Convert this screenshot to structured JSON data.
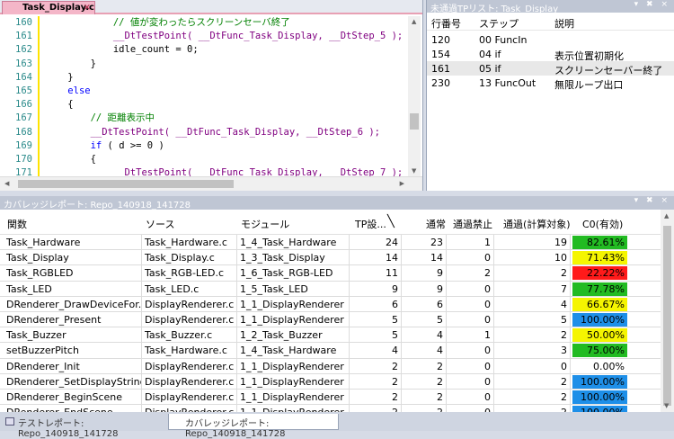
{
  "editor": {
    "tab_label": "Task_Display.c",
    "close_glyph": "×",
    "lines": [
      {
        "n": "160",
        "segs": [
          {
            "t": "            ",
            "c": ""
          },
          {
            "t": "// 値が変わったらスクリーンセーバ終了",
            "c": "cm"
          }
        ]
      },
      {
        "n": "161",
        "segs": [
          {
            "t": "            ",
            "c": ""
          },
          {
            "t": "__DtTestPoint( __DtFunc_Task_Display, __DtStep_5 );",
            "c": "fn"
          }
        ]
      },
      {
        "n": "162",
        "segs": [
          {
            "t": "            idle_count = 0;",
            "c": ""
          }
        ]
      },
      {
        "n": "163",
        "segs": [
          {
            "t": "        }",
            "c": ""
          }
        ]
      },
      {
        "n": "164",
        "segs": [
          {
            "t": "    }",
            "c": ""
          }
        ]
      },
      {
        "n": "165",
        "segs": [
          {
            "t": "    ",
            "c": ""
          },
          {
            "t": "else",
            "c": "kw"
          }
        ]
      },
      {
        "n": "166",
        "segs": [
          {
            "t": "    {",
            "c": ""
          }
        ]
      },
      {
        "n": "167",
        "segs": [
          {
            "t": "        ",
            "c": ""
          },
          {
            "t": "// 距離表示中",
            "c": "cm"
          }
        ]
      },
      {
        "n": "168",
        "segs": [
          {
            "t": "        ",
            "c": ""
          },
          {
            "t": "__DtTestPoint( __DtFunc_Task_Display, __DtStep_6 );",
            "c": "fn"
          }
        ]
      },
      {
        "n": "169",
        "segs": [
          {
            "t": "        ",
            "c": ""
          },
          {
            "t": "if",
            "c": "kw"
          },
          {
            "t": " ( d >= 0 )",
            "c": ""
          }
        ]
      },
      {
        "n": "170",
        "segs": [
          {
            "t": "        {",
            "c": ""
          }
        ]
      },
      {
        "n": "171",
        "segs": [
          {
            "t": "            ",
            "c": ""
          },
          {
            "t": "__DtTestPoint( __DtFunc_Task_Display, __DtStep_7 );",
            "c": "fn"
          }
        ]
      }
    ]
  },
  "untested": {
    "title": "未通過TPリスト: Task_Display",
    "icons": "▾ ✖ ×",
    "headers": [
      "行番号",
      "ステップ",
      "説明"
    ],
    "rows": [
      {
        "line": "120",
        "step": "00 FuncIn",
        "desc": ""
      },
      {
        "line": "154",
        "step": "04 if",
        "desc": "表示位置初期化"
      },
      {
        "line": "161",
        "step": "05 if",
        "desc": "スクリーンセーバー終了",
        "selected": true
      },
      {
        "line": "230",
        "step": "13 FuncOut",
        "desc": "無限ループ出口"
      }
    ]
  },
  "coverage": {
    "title": "カバレッジレポート: Repo_140918_141728",
    "icons": "▾ ✖ ×",
    "headers": {
      "func": "関数",
      "src": "ソース",
      "mod": "モジュール",
      "tp": "TP設...",
      "pass": "通常",
      "ban": "通過禁止",
      "calc": "通過(計算対象)",
      "c0": "C0(有効)"
    },
    "rows": [
      {
        "func": "Task_Hardware",
        "src": "Task_Hardware.c",
        "mod": "1_4_Task_Hardware",
        "tp": "24",
        "pass": "23",
        "ban": "1",
        "calc": "19",
        "c0": "82.61%",
        "color": "#22bb22"
      },
      {
        "func": "Task_Display",
        "src": "Task_Display.c",
        "mod": "1_3_Task_Display",
        "tp": "14",
        "pass": "14",
        "ban": "0",
        "calc": "10",
        "c0": "71.43%",
        "color": "#f5f500"
      },
      {
        "func": "Task_RGBLED",
        "src": "Task_RGB-LED.c",
        "mod": "1_6_Task_RGB-LED",
        "tp": "11",
        "pass": "9",
        "ban": "2",
        "calc": "2",
        "c0": "22.22%",
        "color": "#ff1a1a"
      },
      {
        "func": "Task_LED",
        "src": "Task_LED.c",
        "mod": "1_5_Task_LED",
        "tp": "9",
        "pass": "9",
        "ban": "0",
        "calc": "7",
        "c0": "77.78%",
        "color": "#22bb22"
      },
      {
        "func": "DRenderer_DrawDeviceFor...",
        "src": "DisplayRenderer.c",
        "mod": "1_1_DisplayRenderer",
        "tp": "6",
        "pass": "6",
        "ban": "0",
        "calc": "4",
        "c0": "66.67%",
        "color": "#f5f500"
      },
      {
        "func": "DRenderer_Present",
        "src": "DisplayRenderer.c",
        "mod": "1_1_DisplayRenderer",
        "tp": "5",
        "pass": "5",
        "ban": "0",
        "calc": "5",
        "c0": "100.00%",
        "color": "#1e8fe8"
      },
      {
        "func": "Task_Buzzer",
        "src": "Task_Buzzer.c",
        "mod": "1_2_Task_Buzzer",
        "tp": "5",
        "pass": "4",
        "ban": "1",
        "calc": "2",
        "c0": "50.00%",
        "color": "#f5f500"
      },
      {
        "func": "setBuzzerPitch",
        "src": "Task_Hardware.c",
        "mod": "1_4_Task_Hardware",
        "tp": "4",
        "pass": "4",
        "ban": "0",
        "calc": "3",
        "c0": "75.00%",
        "color": "#22bb22"
      },
      {
        "func": "DRenderer_Init",
        "src": "DisplayRenderer.c",
        "mod": "1_1_DisplayRenderer",
        "tp": "2",
        "pass": "2",
        "ban": "0",
        "calc": "0",
        "c0": "0.00%",
        "color": "#ffffff"
      },
      {
        "func": "DRenderer_SetDisplayString",
        "src": "DisplayRenderer.c",
        "mod": "1_1_DisplayRenderer",
        "tp": "2",
        "pass": "2",
        "ban": "0",
        "calc": "2",
        "c0": "100.00%",
        "color": "#1e8fe8"
      },
      {
        "func": "DRenderer_BeginScene",
        "src": "DisplayRenderer.c",
        "mod": "1_1_DisplayRenderer",
        "tp": "2",
        "pass": "2",
        "ban": "0",
        "calc": "2",
        "c0": "100.00%",
        "color": "#1e8fe8"
      },
      {
        "func": "DRenderer_EndScene",
        "src": "DisplayRenderer.c",
        "mod": "1_1_DisplayRenderer",
        "tp": "2",
        "pass": "2",
        "ban": "0",
        "calc": "2",
        "c0": "100.00%",
        "color": "#1e8fe8"
      }
    ]
  },
  "bottom_tabs": [
    {
      "label": "テストレポート: Repo_140918_141728",
      "active": false
    },
    {
      "label": "カバレッジレポート: Repo_140918_141728",
      "active": true
    }
  ]
}
